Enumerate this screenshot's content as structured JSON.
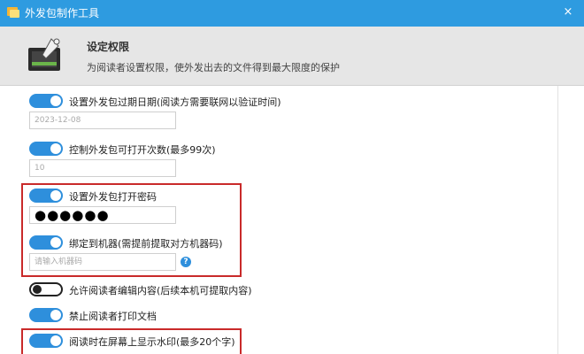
{
  "window": {
    "title": "外发包制作工具",
    "close_glyph": "×"
  },
  "header": {
    "title": "设定权限",
    "subtitle": "为阅读者设置权限，使外发出去的文件得到最大限度的保护"
  },
  "settings": {
    "expiry": {
      "label": "设置外发包过期日期(阅读方需要联网以验证时间)",
      "enabled": true,
      "value": "2023-12-08"
    },
    "open_count": {
      "label": "控制外发包可打开次数(最多99次)",
      "enabled": true,
      "value": "10"
    },
    "password": {
      "label": "设置外发包打开密码",
      "enabled": true,
      "value": "●●●●●●"
    },
    "bind_machine": {
      "label": "绑定到机器(需提前提取对方机器码)",
      "enabled": true,
      "placeholder": "请输入机器码",
      "help_icon": "?"
    },
    "allow_edit": {
      "label": "允许阅读者编辑内容(后续本机可提取内容)",
      "enabled": false
    },
    "forbid_print": {
      "label": "禁止阅读者打印文档",
      "enabled": true
    },
    "watermark": {
      "label": "阅读时在屏幕上显示水印(最多20个字)",
      "enabled": true
    }
  },
  "colors": {
    "titlebar": "#2e9be0",
    "toggle_on": "#2e8fdc",
    "highlight": "#c92a2a",
    "header_bg": "#e6e6e6"
  }
}
